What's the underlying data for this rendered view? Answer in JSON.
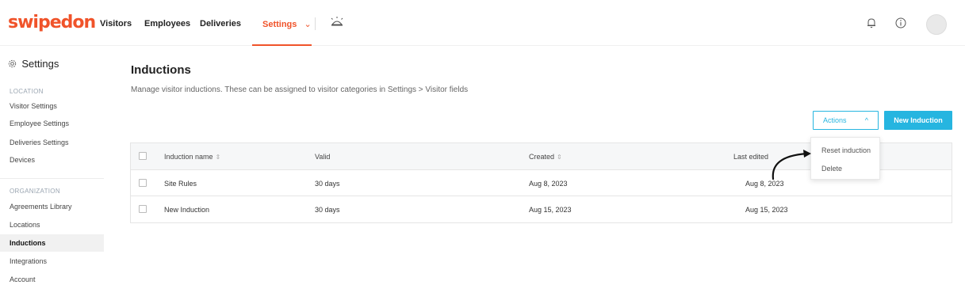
{
  "app": {
    "logo": "swipedon"
  },
  "topnav": {
    "items": [
      {
        "label": "Visitors"
      },
      {
        "label": "Employees"
      },
      {
        "label": "Deliveries"
      },
      {
        "label": "Settings"
      }
    ],
    "settings_chevron": "⌄",
    "icons": {
      "reception": "reception-bell-icon",
      "bell": "notification-bell-icon",
      "info": "info-icon",
      "avatar": "user-avatar"
    }
  },
  "sidebar": {
    "title": "Settings",
    "sections": [
      {
        "heading": "LOCATION",
        "items": [
          {
            "label": "Visitor Settings"
          },
          {
            "label": "Employee Settings"
          },
          {
            "label": "Deliveries Settings"
          },
          {
            "label": "Devices"
          }
        ]
      },
      {
        "heading": "ORGANIZATION",
        "items": [
          {
            "label": "Agreements Library"
          },
          {
            "label": "Locations"
          },
          {
            "label": "Inductions"
          },
          {
            "label": "Integrations"
          },
          {
            "label": "Account"
          }
        ]
      }
    ],
    "active_item": "Inductions"
  },
  "main": {
    "title": "Inductions",
    "description": "Manage visitor inductions. These can be assigned to visitor categories in Settings > Visitor fields",
    "actions_label": "Actions",
    "actions_chevron": "^",
    "new_button_label": "New Induction",
    "actions_menu": [
      {
        "label": "Reset induction"
      },
      {
        "label": "Delete"
      }
    ],
    "table": {
      "columns": [
        "Induction name",
        "Valid",
        "Created",
        "Last edited"
      ],
      "sort_glyph": "⇕",
      "rows": [
        {
          "name": "Site Rules",
          "valid": "30 days",
          "created": "Aug 8, 2023",
          "last_edited": "Aug 8, 2023"
        },
        {
          "name": "New Induction",
          "valid": "30 days",
          "created": "Aug 15, 2023",
          "last_edited": "Aug 15, 2023"
        }
      ]
    }
  },
  "colors": {
    "brand": "#f0532a",
    "accent": "#26b5e0"
  }
}
